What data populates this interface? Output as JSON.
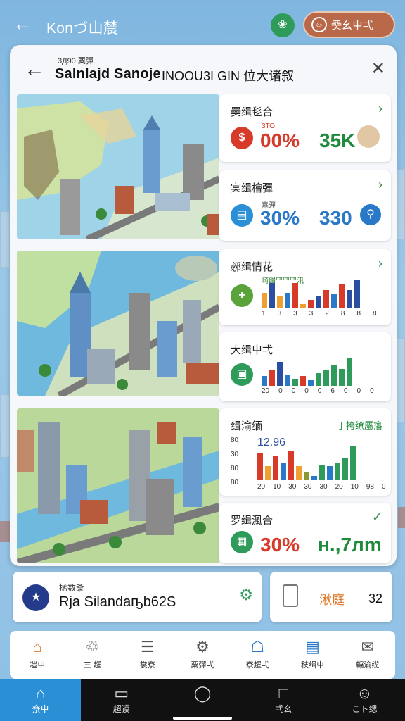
{
  "app": {
    "title": "Konづ山辳",
    "user_button": "奰幺屮弌"
  },
  "header_icons": {
    "back": "back-arrow-icon",
    "green": "leaf-icon",
    "user": "user-icon"
  },
  "panel": {
    "subtitle": "3Д90 粟彈",
    "title": "Salnlajd Sanoje",
    "title_right": "INOOU3I GIN 位大诸叙"
  },
  "stats": [
    {
      "label": "奰缉毝合",
      "sub": "3ТО",
      "value": "00%",
      "right": "35K",
      "accent": "#d83a2a",
      "value_color": "#d83a2a",
      "right_color": "#1f8a3c",
      "icon": "percent-icon"
    },
    {
      "label": "宲缉檜彈",
      "sub": "粟彈",
      "value": "30%",
      "right": "330",
      "accent": "#2a8fd6",
      "value_color": "#2a78c8",
      "right_color": "#2a78c8",
      "icon": "chart-icon"
    },
    {
      "label": "邲缉情花",
      "sub": "崎缉罒罒罒汛",
      "icon": "plus-icon",
      "accent": "#5aa23a",
      "ticks": [
        "1",
        "3",
        "3",
        "3",
        "2",
        "8",
        "8",
        "8"
      ]
    },
    {
      "label": "大缉屮弌",
      "icon": "transit-icon",
      "accent": "#2f9b5a",
      "ticks": [
        "20",
        "0",
        "0",
        "0",
        "0",
        "6",
        "0",
        "0",
        "0"
      ]
    },
    {
      "label": "缉渝缅",
      "right_label": "于挎缭屬籓",
      "value": "12.96",
      "axis": [
        "80",
        "30",
        "80",
        "80"
      ],
      "ticks": [
        "20",
        "10",
        "30",
        "30",
        "30",
        "20",
        "10",
        "98",
        "0"
      ]
    },
    {
      "label": "罗缉渢合",
      "value": "30%",
      "right": "н.,7лm",
      "accent": "#2f9b5a",
      "value_color": "#d83a2a",
      "right_color": "#1f8a3c",
      "icon": "grid-icon"
    }
  ],
  "bars_a": {
    "values": [
      0.55,
      0.9,
      0.45,
      0.55,
      0.9,
      0.15,
      0.3,
      0.45,
      0.65,
      0.5,
      0.85,
      0.65,
      1.0
    ],
    "colors": [
      "#f0a030",
      "#2a4fa0",
      "#f0a030",
      "#2a78c8",
      "#d83a2a",
      "#f0a030",
      "#d83a2a",
      "#2a4fa0",
      "#d83a2a",
      "#2a78c8",
      "#d83a2a",
      "#2a4fa0",
      "#2a4fa0"
    ]
  },
  "bars_b": {
    "values": [
      0.35,
      0.55,
      0.85,
      0.4,
      0.25,
      0.35,
      0.2,
      0.45,
      0.55,
      0.75,
      0.6,
      1.0
    ],
    "colors": [
      "#2a78c8",
      "#d83a2a",
      "#2a4fa0",
      "#2a78c8",
      "#2f9b5a",
      "#d83a2a",
      "#2a78c8",
      "#2f9b5a",
      "#2f9b5a",
      "#2f9b5a",
      "#2f9b5a",
      "#2f9b5a"
    ]
  },
  "bars_c": {
    "values": [
      0.7,
      0.35,
      0.6,
      0.45,
      0.75,
      0.35,
      0.2,
      0.1,
      0.4,
      0.35,
      0.45,
      0.55,
      0.85
    ],
    "colors": [
      "#d83a2a",
      "#f0a030",
      "#d83a2a",
      "#2a78c8",
      "#d83a2a",
      "#f0a030",
      "#8a9a30",
      "#2a78c8",
      "#2f9b5a",
      "#2a78c8",
      "#2f9b5a",
      "#2f9b5a",
      "#2f9b5a"
    ]
  },
  "bottom": {
    "left_label": "掹数洜",
    "left_value": "Rja Silandaҧb62S",
    "right_label": "湫庭",
    "right_value": "32"
  },
  "tabs": [
    {
      "label": "凒屮",
      "icon": "home-icon",
      "color": "#e07a2a"
    },
    {
      "label": "三 趯",
      "icon": "trash-icon",
      "color": "#555"
    },
    {
      "label": "裳尞",
      "icon": "list-icon",
      "color": "#555"
    },
    {
      "label": "粟彈弌",
      "icon": "gear-icon",
      "color": "#555"
    },
    {
      "label": "尞趯弌",
      "icon": "bank-icon",
      "color": "#2a78c8"
    },
    {
      "label": "秓缉屮",
      "icon": "card-icon",
      "color": "#2a78c8"
    },
    {
      "label": "輾渝缆",
      "icon": "chat-icon",
      "color": "#555"
    }
  ],
  "sysnav": [
    {
      "label": "尞屮",
      "icon": "home-icon"
    },
    {
      "label": "超谟",
      "icon": "tablet-icon"
    },
    {
      "label": "",
      "icon": "circle-icon"
    },
    {
      "label": "弌幺",
      "icon": "square-icon"
    },
    {
      "label": "こト缌",
      "icon": "person-icon"
    }
  ]
}
